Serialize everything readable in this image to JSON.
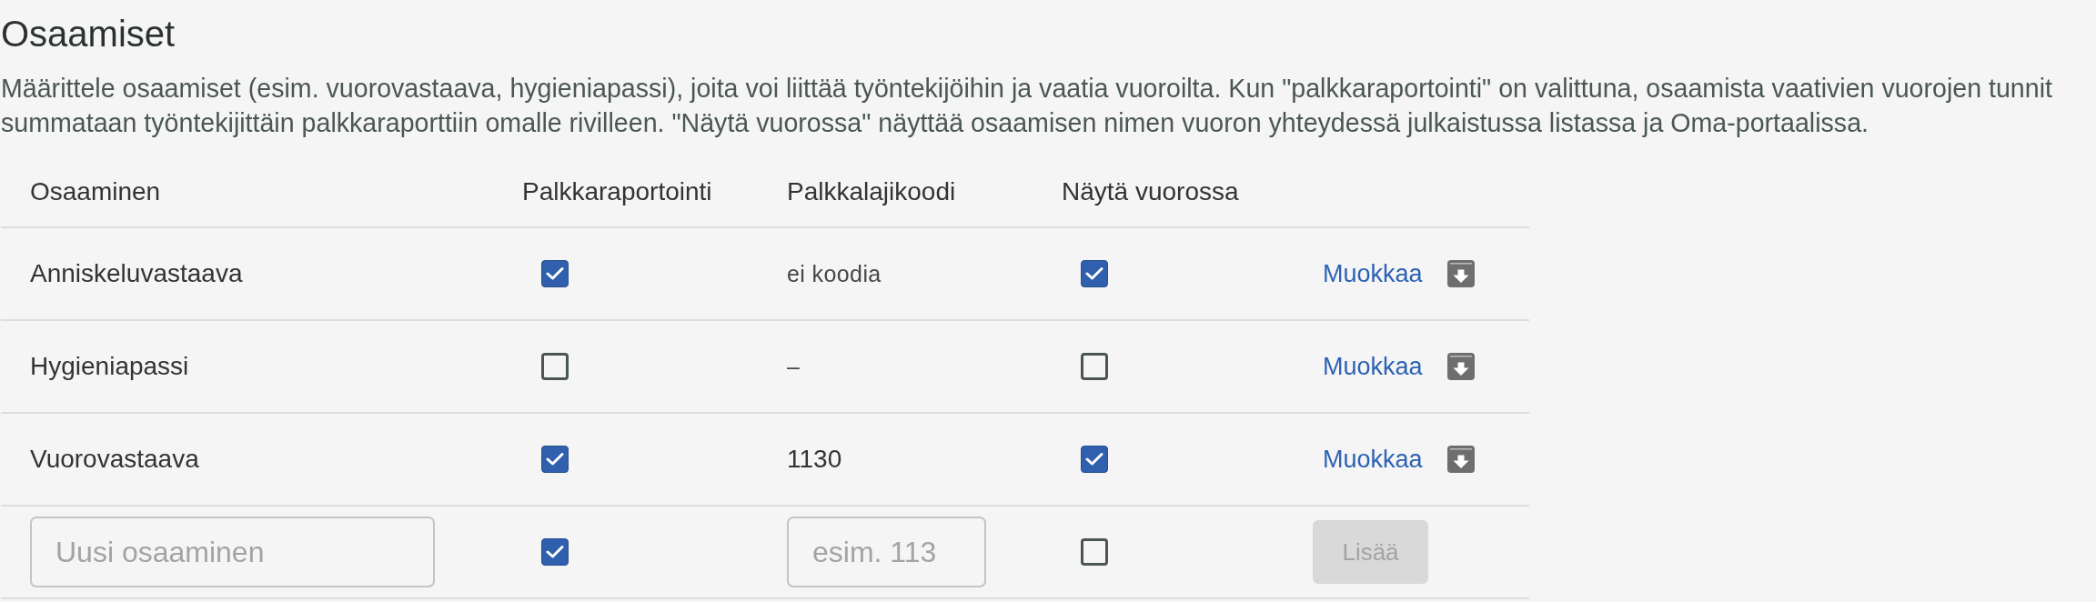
{
  "title": "Osaamiset",
  "description": "Määrittele osaamiset (esim. vuorovastaava, hygieniapassi), joita voi liittää työntekijöihin ja vaatia vuoroilta. Kun \"palkkaraportointi\" on valittuna, osaamista vaativien vuorojen tunnit summataan työntekijittäin palkkaraporttiin omalle rivilleen. \"Näytä vuorossa\" näyttää osaamisen nimen vuoron yhteydessä julkaistussa listassa ja Oma-portaalissa.",
  "table": {
    "columns": [
      "Osaaminen",
      "Palkkaraportointi",
      "Palkkalajikoodi",
      "Näytä vuorossa"
    ],
    "rows": [
      {
        "name": "Anniskeluvastaava",
        "payroll_reporting": true,
        "pay_code": {
          "kind": "missing",
          "text": "ei koodia"
        },
        "show_in_shift": true,
        "edit_link": "Muokkaa"
      },
      {
        "name": "Hygieniapassi",
        "payroll_reporting": false,
        "pay_code": {
          "kind": "missing",
          "text": "–"
        },
        "show_in_shift": false,
        "edit_link": "Muokkaa"
      },
      {
        "name": "Vuorovastaava",
        "payroll_reporting": true,
        "pay_code": {
          "kind": "code",
          "text": "1130"
        },
        "show_in_shift": true,
        "edit_link": "Muokkaa"
      }
    ],
    "new_row": {
      "name_field": {
        "placeholder": "Uusi osaaminen"
      },
      "payroll_reporting": true,
      "pay_code_field": {
        "placeholder": "esim. 113"
      },
      "show_in_shift": false,
      "add_button": {
        "label": "Lisää",
        "disabled": true
      }
    }
  }
}
